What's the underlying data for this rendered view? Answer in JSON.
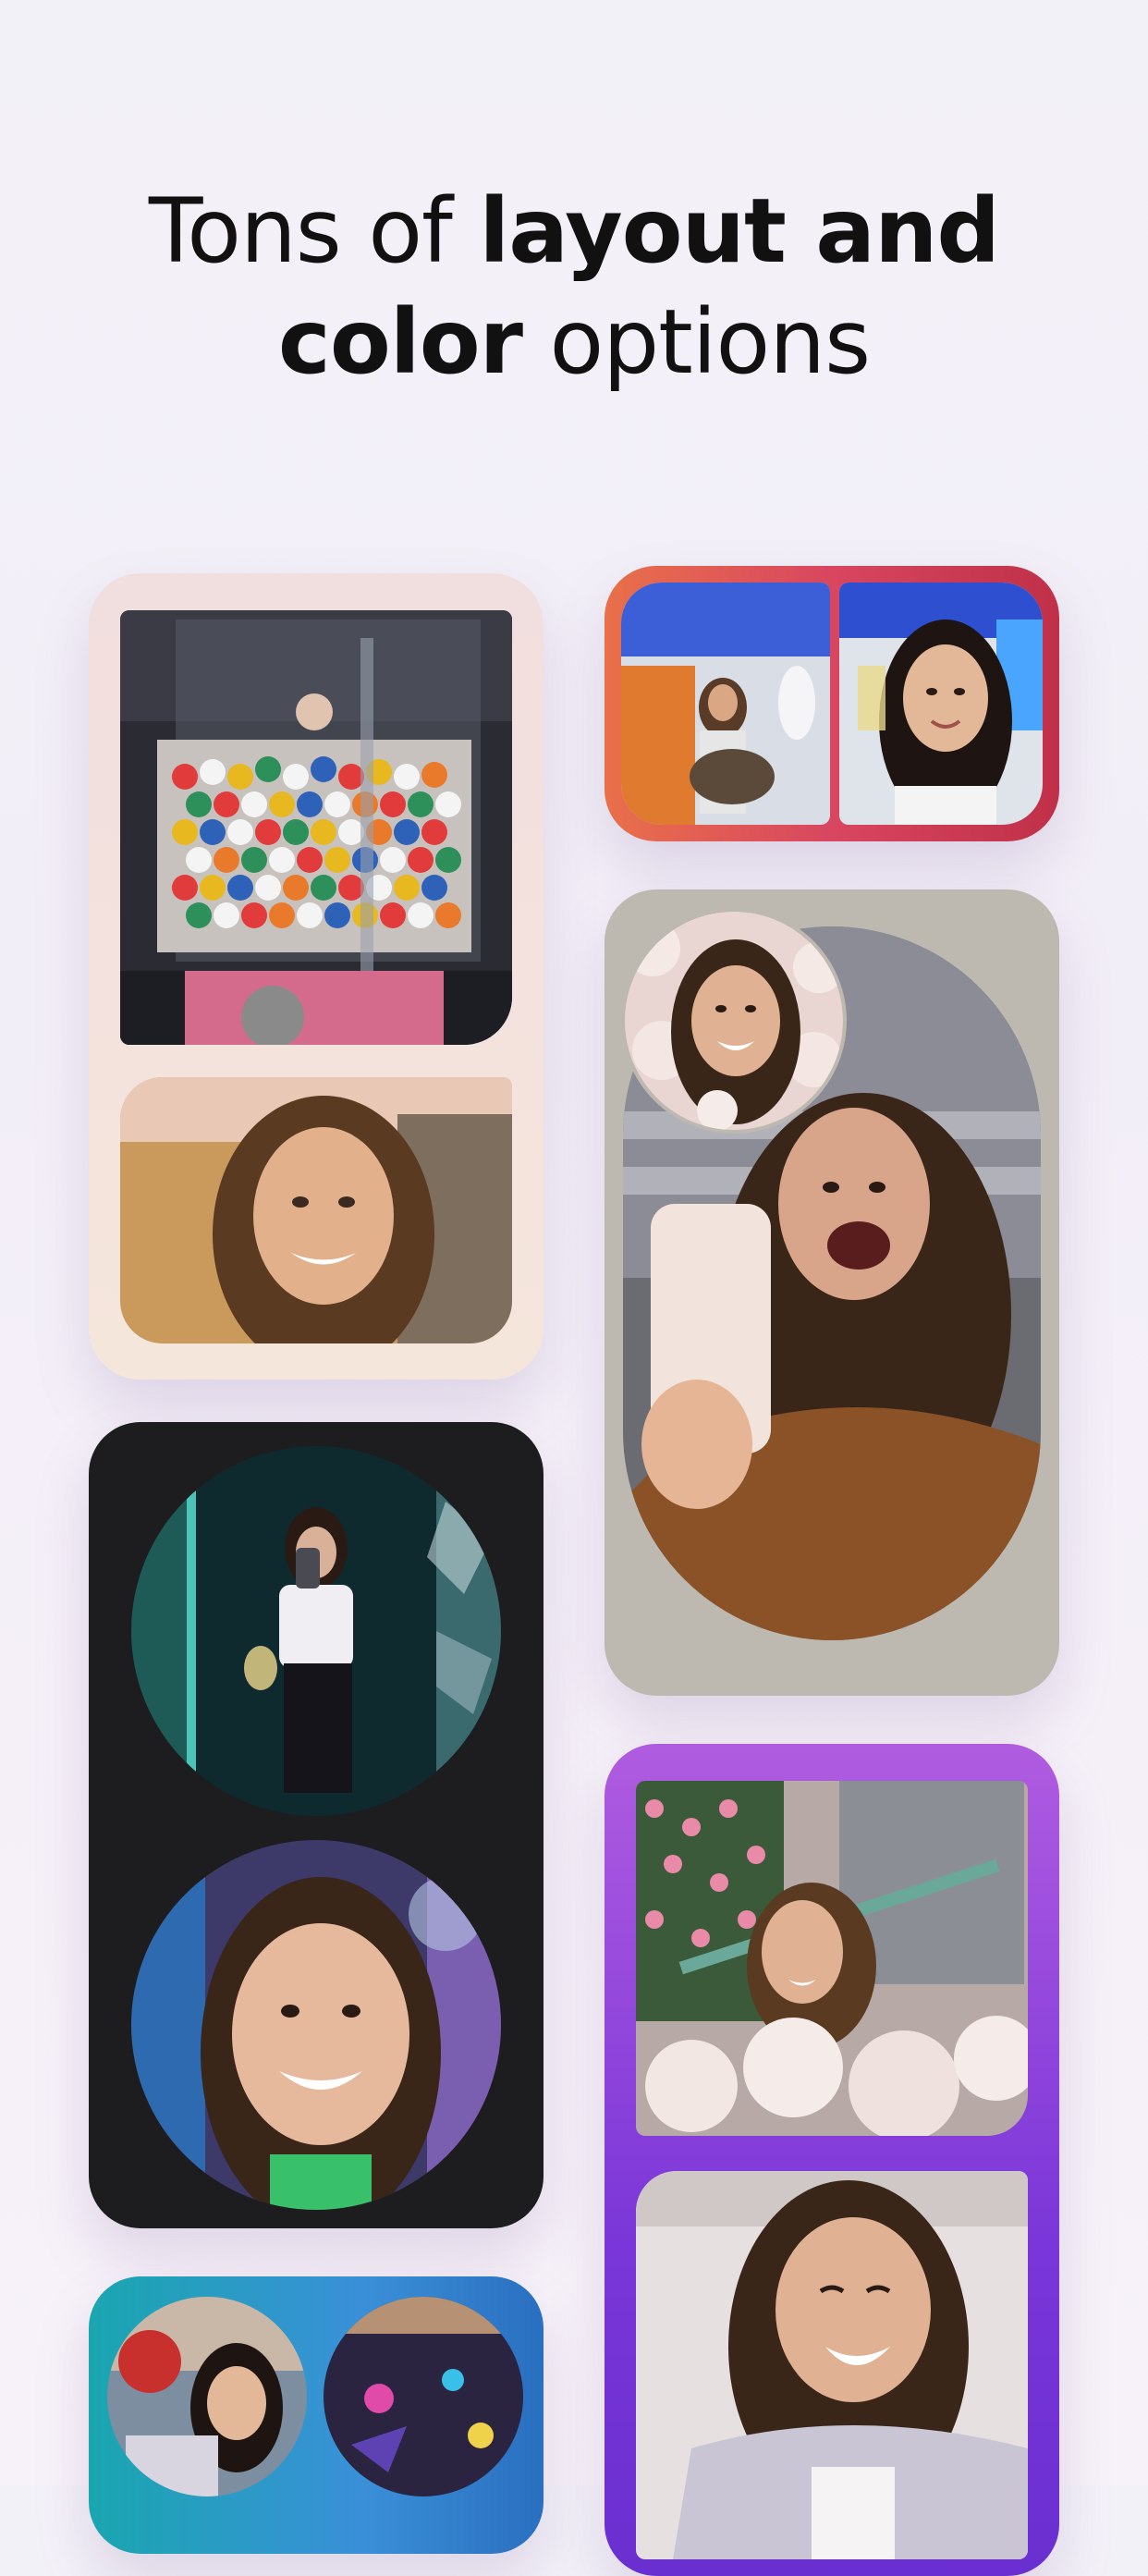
{
  "headline": {
    "line1_light": "Tons of ",
    "line1_bold": "layout and",
    "line2_bold": "color",
    "line2_light": " options"
  },
  "cards": [
    {
      "name": "cream",
      "layout": "two-stacked-rectangles",
      "background": "#f3e2dc",
      "photos": [
        "gumball-machine",
        "smiling-woman-selfie"
      ]
    },
    {
      "name": "red",
      "layout": "two-side-by-side",
      "background": "#d84660",
      "photos": [
        "friend-on-plane",
        "woman-toast-on-plane"
      ]
    },
    {
      "name": "grey",
      "layout": "circle-over-capsule",
      "background": "#bdb9b0",
      "photos": [
        "woman-in-ball-pit",
        "woman-phone-selfie"
      ]
    },
    {
      "name": "black",
      "layout": "two-circles",
      "background": "#1d1d1f",
      "photos": [
        "mirror-selfie",
        "laughing-woman-closeup"
      ]
    },
    {
      "name": "purple",
      "layout": "two-stacked-rectangles",
      "background": "#7a36d8",
      "photos": [
        "woman-ball-pit-flowers",
        "woman-laughing-sweater"
      ]
    },
    {
      "name": "teal",
      "layout": "two-circles-side-by-side",
      "background": "#2a90c8",
      "photos": [
        "friends-with-balloon",
        "neon-room"
      ]
    }
  ]
}
